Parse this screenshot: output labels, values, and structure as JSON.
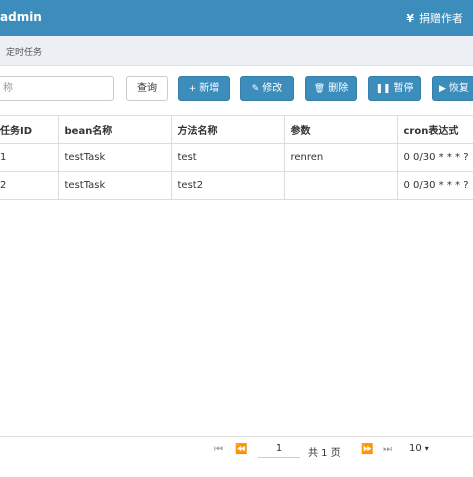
{
  "header": {
    "brand": "admin",
    "donate_icon": "yen-icon",
    "donate_icon_glyph": "¥",
    "donate_label": "捐赠作者",
    "color": "#3c8dbc"
  },
  "breadcrumb": {
    "current": "定时任务"
  },
  "toolbar": {
    "search_placeholder": "称",
    "query_label": "查询",
    "add_label": "新增",
    "add_icon": "+",
    "edit_label": "修改",
    "edit_icon": "✎",
    "delete_label": "删除",
    "delete_icon": "🗑",
    "pause_label": "暂停",
    "pause_icon": "❚❚",
    "resume_label": "恢复",
    "resume_icon": "▶"
  },
  "table": {
    "columns": [
      "任务ID",
      "bean名称",
      "方法名称",
      "参数",
      "cron表达式"
    ],
    "rows": [
      [
        "1",
        "testTask",
        "test",
        "renren",
        "0 0/30 * * * ?"
      ],
      [
        "2",
        "testTask",
        "test2",
        "",
        "0 0/30 * * * ?"
      ]
    ]
  },
  "pager": {
    "first_icon": "⏮",
    "prev_icon": "⏪",
    "page_value": "1",
    "total_text": "共 1 页",
    "next_icon": "⏩",
    "last_icon": "⏭",
    "page_size": "10",
    "size_caret": "▾"
  }
}
